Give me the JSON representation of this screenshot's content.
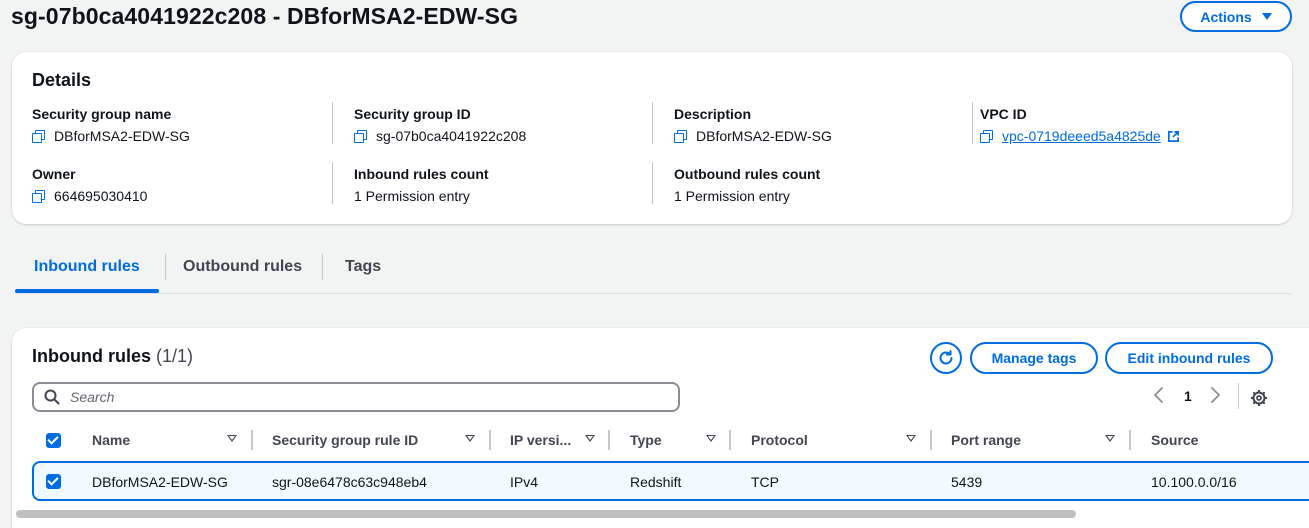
{
  "page": {
    "title": "sg-07b0ca4041922c208 - DBforMSA2-EDW-SG",
    "actions_label": "Actions"
  },
  "details": {
    "heading": "Details",
    "fields": [
      {
        "label": "Security group name",
        "value": "DBforMSA2-EDW-SG"
      },
      {
        "label": "Security group ID",
        "value": "sg-07b0ca4041922c208"
      },
      {
        "label": "Description",
        "value": "DBforMSA2-EDW-SG"
      },
      {
        "label": "VPC ID",
        "value": "vpc-0719deeed5a4825de"
      },
      {
        "label": "Owner",
        "value": "664695030410"
      },
      {
        "label": "Inbound rules count",
        "value": "1 Permission entry"
      },
      {
        "label": "Outbound rules count",
        "value": "1 Permission entry"
      }
    ]
  },
  "tabs": [
    "Inbound rules",
    "Outbound rules",
    "Tags"
  ],
  "inbound": {
    "heading": "Inbound rules",
    "count": "(1/1)",
    "manage_tags_label": "Manage tags",
    "edit_label": "Edit inbound rules",
    "search_placeholder": "Search",
    "page_number": "1",
    "columns": [
      "Name",
      "Security group rule ID",
      "IP versi...",
      "Type",
      "Protocol",
      "Port range",
      "Source"
    ],
    "rows": [
      {
        "name": "DBforMSA2-EDW-SG",
        "rule_id": "sgr-08e6478c63c948eb4",
        "ip_version": "IPv4",
        "type": "Redshift",
        "protocol": "TCP",
        "port_range": "5439",
        "source": "10.100.0.0/16",
        "selected": true
      }
    ]
  },
  "colors": {
    "accent": "#006ce0",
    "background": "#f2f3f3",
    "selected_row": "#f0fbff"
  },
  "icons": [
    "copy-icon",
    "external-link-icon",
    "refresh-icon",
    "search-icon",
    "chevron-left-icon",
    "chevron-right-icon",
    "settings-gear-icon",
    "sort-caret-icon",
    "caret-down-icon"
  ]
}
